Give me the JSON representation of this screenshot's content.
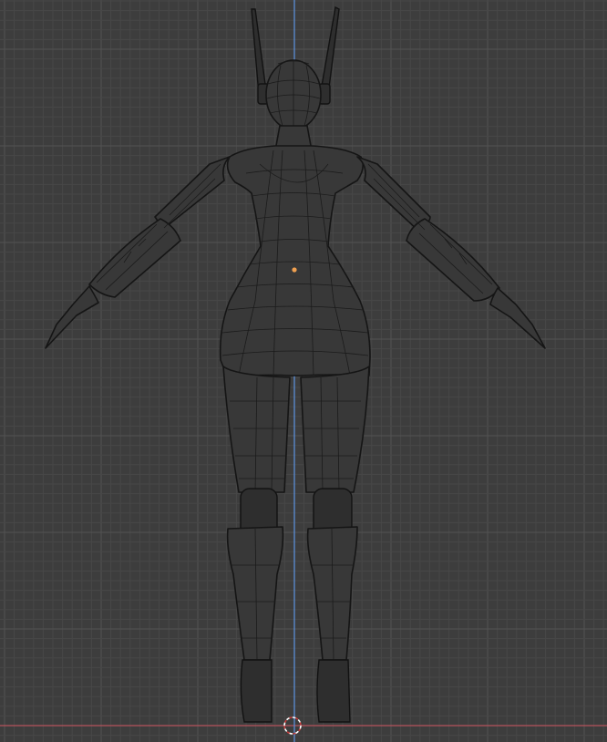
{
  "viewport": {
    "view": "front-orthographic",
    "shading": "wireframe",
    "grid": true,
    "axis_colors": {
      "x": "#b5525b",
      "z": "#5b8ed6"
    },
    "background": "#3d3d3d",
    "origin_color": "#f0a050",
    "cursor_color": "#ffffff"
  }
}
